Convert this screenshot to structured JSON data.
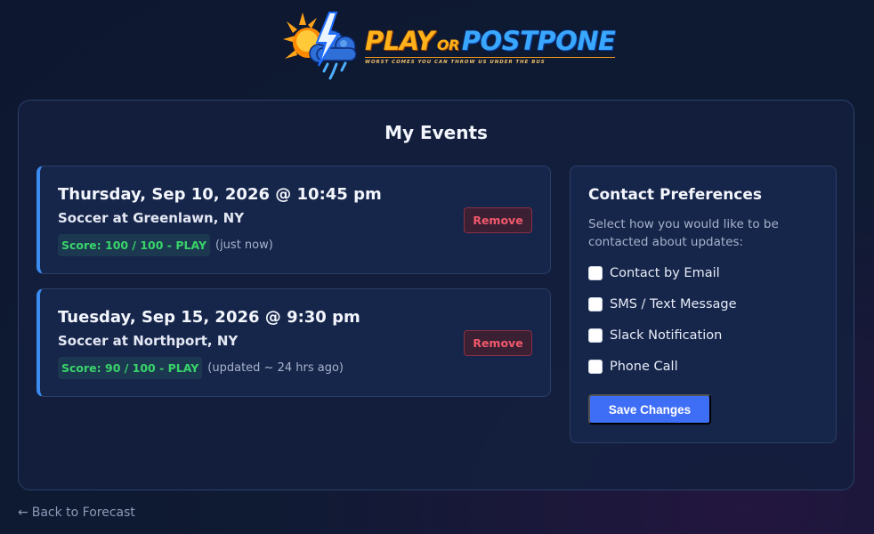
{
  "brand": {
    "play": "PLAY",
    "or": "OR",
    "postpone": "POSTPONE",
    "tagline": "WORST COMES YOU CAN THROW US UNDER THE BUS"
  },
  "page": {
    "title": "My Events"
  },
  "events": [
    {
      "date": "Thursday, Sep 10, 2026 @ 10:45 pm",
      "location": "Soccer at Greenlawn, NY",
      "score": "Score: 100 / 100 - PLAY",
      "updated": "(just now)",
      "remove_label": "Remove"
    },
    {
      "date": "Tuesday, Sep 15, 2026 @ 9:30 pm",
      "location": "Soccer at Northport, NY",
      "score": "Score: 90 / 100 - PLAY",
      "updated": "(updated ~ 24 hrs ago)",
      "remove_label": "Remove"
    }
  ],
  "contact": {
    "title": "Contact Preferences",
    "description": "Select how you would like to be contacted about updates:",
    "options": [
      {
        "label": "Contact by Email",
        "checked": false
      },
      {
        "label": "SMS / Text Message",
        "checked": false
      },
      {
        "label": "Slack Notification",
        "checked": false
      },
      {
        "label": "Phone Call",
        "checked": false
      }
    ],
    "save_label": "Save Changes"
  },
  "nav": {
    "back_label": "Back to Forecast",
    "back_icon": "arrow-left-icon"
  },
  "colors": {
    "accent": "#3f6ef6",
    "play_score": "#38d46a",
    "remove": "#f0596c",
    "event_border": "#3b8bf0"
  }
}
